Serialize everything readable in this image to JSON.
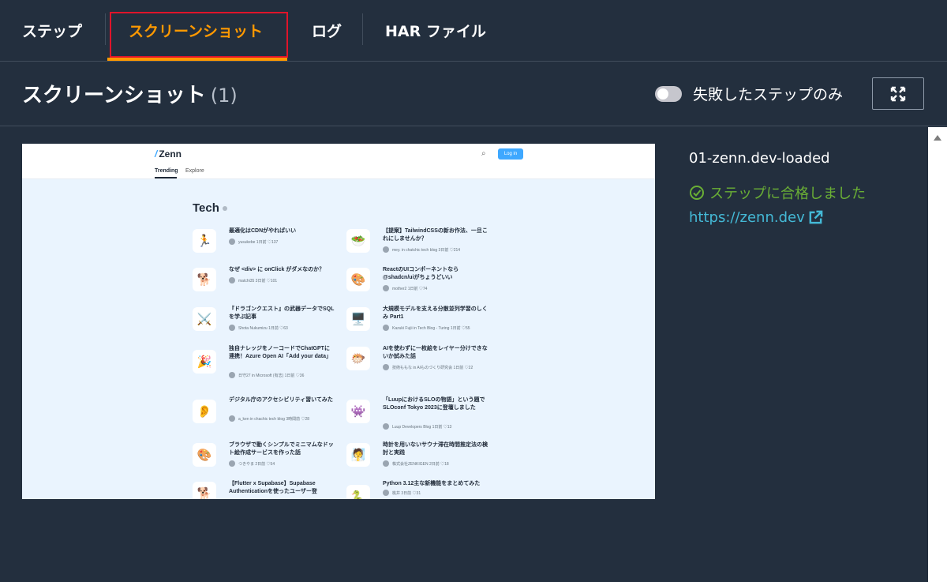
{
  "tabs": [
    {
      "label": "ステップ"
    },
    {
      "label": "スクリーンショット"
    },
    {
      "label": "ログ"
    },
    {
      "label": "HAR ファイル"
    }
  ],
  "header": {
    "title": "スクリーンショット",
    "count": "(1)",
    "toggle_label": "失敗したステップのみ"
  },
  "preview": {
    "logo": "Zenn",
    "login": "Log in",
    "nav": [
      "Trending",
      "Explore"
    ],
    "section_title": "Tech",
    "articles": [
      {
        "title": "最適化はCDNがやればいい",
        "meta": "yusukebe 1日前 ♡137",
        "icon": "🏃"
      },
      {
        "title": "【提案】TailwindCSSの新お作法、一旦これにしませんか？",
        "meta": "mey. in chatchic tech blog 3日前 ♡214",
        "icon": "🥗"
      },
      {
        "title": "なぜ <div> に onClick がダメなのか？",
        "meta": "matchi35 3日前 ♡101",
        "icon": "🐕"
      },
      {
        "title": "ReactのUIコンポーネントなら@shadcn/uiがちょうどいい",
        "meta": "mother2 1日前 ♡74",
        "icon": "🎨"
      },
      {
        "title": "『ドラゴンクエスト』の武器データでSQLを学ぶ記事",
        "meta": "Shota Nukumizu 1日前 ♡63",
        "icon": "⚔️"
      },
      {
        "title": "大規模モデルを支える分散並列学習のしくみ Part1",
        "meta": "Kazuki Fujii in Tech Blog - Turing 1日前 ♡55",
        "icon": "🖥️"
      },
      {
        "title": "独自ナレッジをノーコードでChatGPTに連携！Azure Open AI「Add your data」",
        "meta": "日守27 in Microsoft (有志) 1日前 ♡36",
        "icon": "🎉"
      },
      {
        "title": "AIを使わずに一枚絵をレイヤー分けできないか試みた話",
        "meta": "技術ももな in AIものづくり研究会 1日前 ♡22",
        "icon": "🐡"
      },
      {
        "title": "デジタル庁のアクセシビリティ習いてみた",
        "meta": "a_ken in chachic tech blog 3時間前 ♡28",
        "icon": "👂"
      },
      {
        "title": "「LuupにおけるSLOの物語」という題でSLOconf Tokyo 2023に登壇しました",
        "meta": "Luup Developers Blog 1日前 ♡13",
        "icon": "👾"
      },
      {
        "title": "ブラウザで動くシンプルでミニマムなドット絵作成サービスを作った話",
        "meta": "つきやま 2日前 ♡54",
        "icon": "🎨"
      },
      {
        "title": "時計を用いないサウナ滞在時間推定法の検討と実践",
        "meta": "株式会社ZENKIGEN 2日前 ♡18",
        "icon": "🧖"
      },
      {
        "title": "【Flutter x Supabase】Supabase Authenticationを使ったユーザー登",
        "meta": "",
        "icon": "🐕"
      },
      {
        "title": "Python 3.12主な新機能をまとめてみた",
        "meta": "桃井 3日前 ♡31",
        "icon": "🐍"
      }
    ]
  },
  "step": {
    "name": "01-zenn.dev-loaded",
    "status": "ステップに合格しました",
    "url": "https://zenn.dev"
  },
  "colors": {
    "background": "#232f3e",
    "active_tab": "#ff9900",
    "success": "#6aaf35",
    "link": "#44b9d6"
  }
}
